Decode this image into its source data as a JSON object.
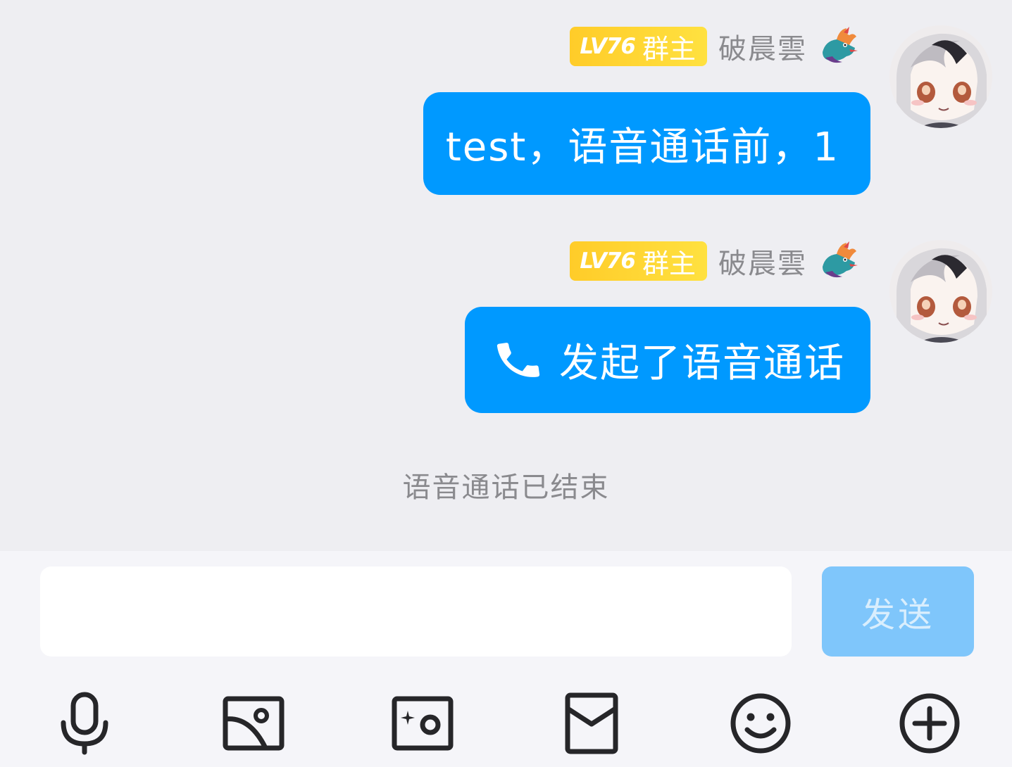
{
  "messages": [
    {
      "badge": {
        "level": "LV76",
        "role": "群主"
      },
      "sender": "破晨雲",
      "text": "test，语音通话前，1"
    },
    {
      "badge": {
        "level": "LV76",
        "role": "群主"
      },
      "sender": "破晨雲",
      "text": "发起了语音通话"
    }
  ],
  "system_notice": "语音通话已结束",
  "composer": {
    "input_value": "",
    "send_label": "发送"
  },
  "colors": {
    "bubble": "#0099ff",
    "send_disabled": "#7fc6fb",
    "badge_start": "#ffcc29",
    "badge_end": "#ffe140"
  },
  "toolbar": [
    "microphone-icon",
    "image-icon",
    "camera-icon",
    "red-packet-icon",
    "emoji-icon",
    "plus-icon"
  ]
}
